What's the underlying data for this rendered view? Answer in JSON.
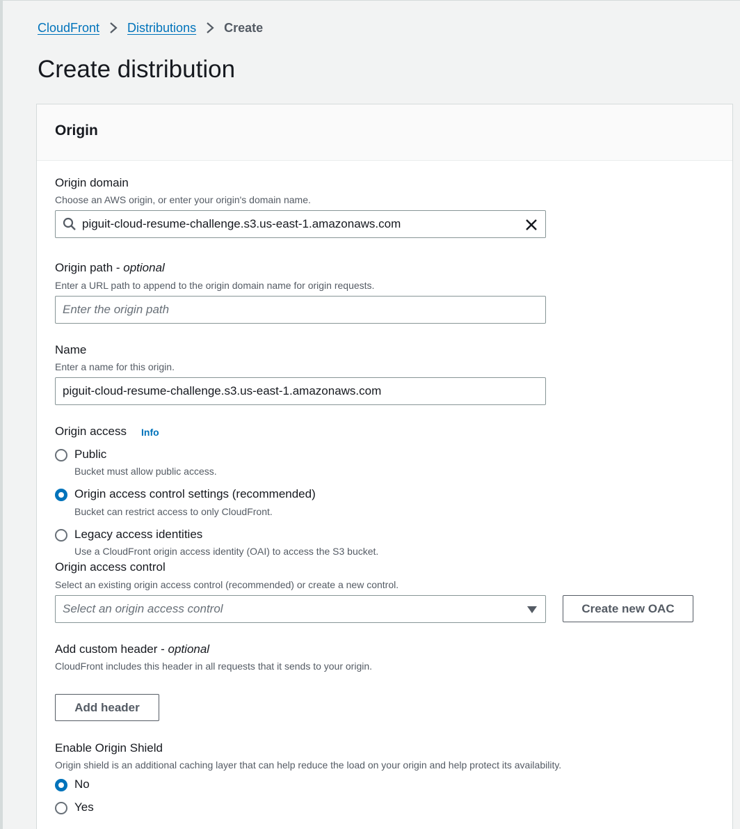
{
  "breadcrumb": {
    "items": [
      "CloudFront",
      "Distributions"
    ],
    "current": "Create"
  },
  "page_title": "Create distribution",
  "panel": {
    "title": "Origin",
    "origin_domain": {
      "label": "Origin domain",
      "description": "Choose an AWS origin, or enter your origin's domain name.",
      "value": "piguit-cloud-resume-challenge.s3.us-east-1.amazonaws.com",
      "search_icon": "search-icon",
      "clear_icon": "close-icon"
    },
    "origin_path": {
      "label": "Origin path - ",
      "optional": "optional",
      "description": "Enter a URL path to append to the origin domain name for origin requests.",
      "placeholder": "Enter the origin path"
    },
    "name": {
      "label": "Name",
      "description": "Enter a name for this origin.",
      "value": "piguit-cloud-resume-challenge.s3.us-east-1.amazonaws.com"
    },
    "origin_access": {
      "label": "Origin access",
      "info": "Info",
      "options": [
        {
          "label": "Public",
          "description": "Bucket must allow public access.",
          "selected": false
        },
        {
          "label": "Origin access control settings (recommended)",
          "description": "Bucket can restrict access to only CloudFront.",
          "selected": true
        },
        {
          "label": "Legacy access identities",
          "description": "Use a CloudFront origin access identity (OAI) to access the S3 bucket.",
          "selected": false
        }
      ]
    },
    "origin_access_control": {
      "label": "Origin access control",
      "description": "Select an existing origin access control (recommended) or create a new control.",
      "placeholder": "Select an origin access control",
      "create_button": "Create new OAC"
    },
    "custom_header": {
      "label": "Add custom header - ",
      "optional": "optional",
      "description": "CloudFront includes this header in all requests that it sends to your origin.",
      "button": "Add header"
    },
    "origin_shield": {
      "label": "Enable Origin Shield",
      "description": "Origin shield is an additional caching layer that can help reduce the load on your origin and help protect its availability.",
      "options": [
        {
          "label": "No",
          "selected": true
        },
        {
          "label": "Yes",
          "selected": false
        }
      ]
    }
  },
  "colors": {
    "link": "#0073bb",
    "background": "#f2f3f3",
    "text": "#16191f",
    "muted": "#545b64"
  }
}
